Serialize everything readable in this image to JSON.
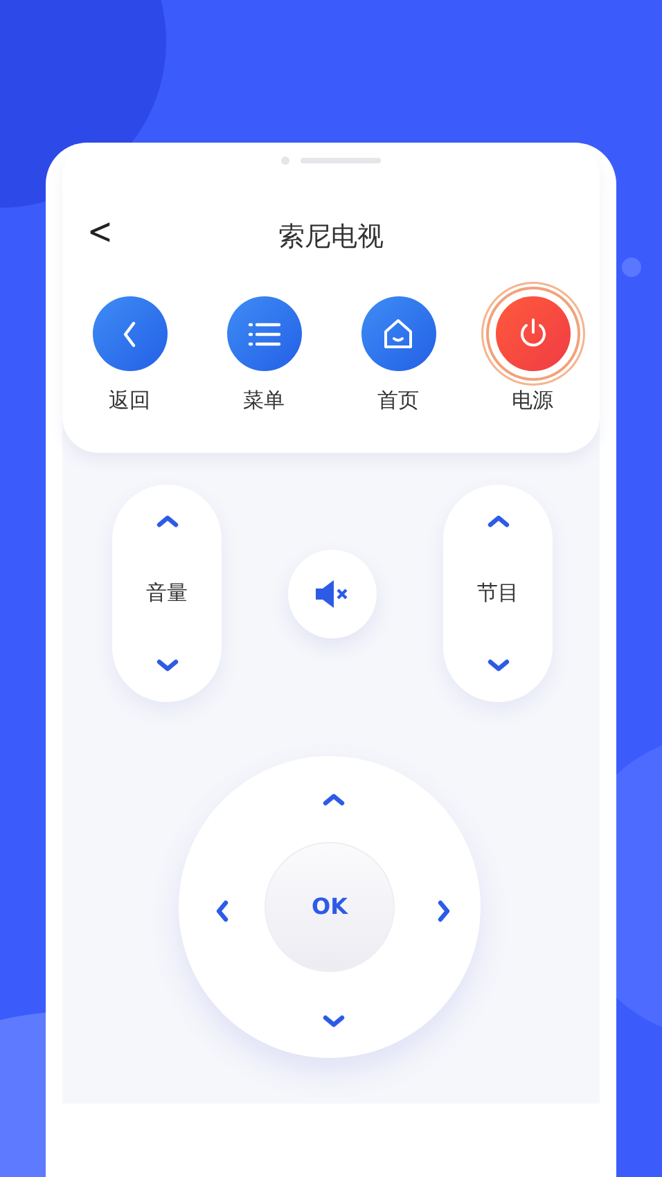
{
  "header": {
    "back_symbol": "<",
    "title": "索尼电视"
  },
  "top_buttons": [
    {
      "kind": "back",
      "label": "返回"
    },
    {
      "kind": "menu",
      "label": "菜单"
    },
    {
      "kind": "home",
      "label": "首页"
    },
    {
      "kind": "power",
      "label": "电源"
    }
  ],
  "volume": {
    "label": "音量"
  },
  "channel": {
    "label": "节目"
  },
  "dpad": {
    "ok_label": "OK"
  }
}
